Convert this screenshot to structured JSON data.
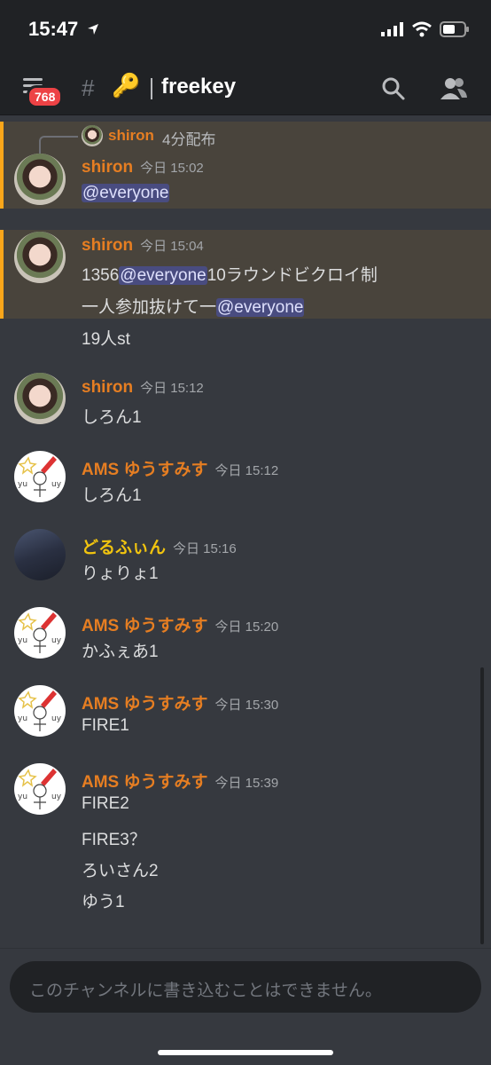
{
  "status_bar": {
    "time": "15:47"
  },
  "header": {
    "badge_count": "768",
    "channel_emoji": "🔑",
    "channel_name": "freekey"
  },
  "reply": {
    "name": "shiron",
    "text": "4分配布"
  },
  "messages": [
    {
      "author": "shiron",
      "time": "今日 15:02",
      "lines": [
        [
          {
            "m": "@everyone"
          }
        ]
      ],
      "highlight": true
    },
    {
      "author": "shiron",
      "time": "今日 15:04",
      "highlight": true,
      "lines": [
        [
          {
            "t": "1356"
          },
          {
            "m": "@everyone"
          },
          {
            "t": "10ラウンドビクロイ制"
          }
        ],
        [
          {
            "t": "一人参加抜けて一"
          },
          {
            "m": "@everyone"
          }
        ],
        [
          {
            "t": "19人st"
          }
        ]
      ]
    },
    {
      "author": "shiron",
      "time": "今日 15:12",
      "lines": [
        [
          {
            "t": "しろん1"
          }
        ]
      ]
    },
    {
      "author": "AMS ゆうすみす",
      "time": "今日 15:12",
      "lines": [
        [
          {
            "t": "しろん1"
          }
        ]
      ]
    },
    {
      "author": "どるふぃん",
      "time": "今日 15:16",
      "lines": [
        [
          {
            "t": "りょりょ1"
          }
        ]
      ]
    },
    {
      "author": "AMS ゆうすみす",
      "time": "今日 15:20",
      "lines": [
        [
          {
            "t": "かふぇあ1"
          }
        ]
      ]
    },
    {
      "author": "AMS ゆうすみす",
      "time": "今日 15:30",
      "lines": [
        [
          {
            "t": "FIRE1"
          }
        ]
      ]
    },
    {
      "author": "AMS ゆうすみす",
      "time": "今日 15:39",
      "lines": [
        [
          {
            "t": "FIRE2"
          }
        ],
        [
          {
            "t": "FIRE3？"
          }
        ],
        [
          {
            "t": "ろいさん2"
          }
        ],
        [
          {
            "t": "ゆう1"
          }
        ]
      ]
    }
  ],
  "input": {
    "placeholder": "このチャンネルに書き込むことはできません。"
  },
  "colors": {
    "mention_bg": "#494c80",
    "highlight_bg": "#49443c",
    "highlight_border": "#faa61a",
    "name_orange": "#e67e22",
    "name_yellow": "#f1c40f"
  }
}
